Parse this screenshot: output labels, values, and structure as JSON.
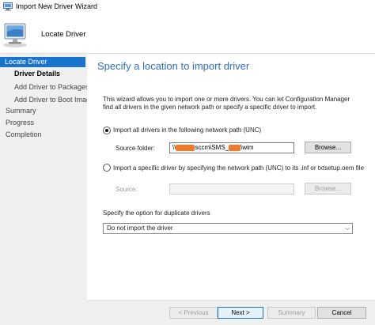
{
  "window": {
    "title": "Import New Driver Wizard"
  },
  "header": {
    "title": "Locate Driver"
  },
  "sidebar": {
    "items": [
      {
        "label": "Locate Driver",
        "state": "active"
      },
      {
        "label": "Driver Details",
        "state": "bold"
      },
      {
        "label": "Add Driver to Packages",
        "state": "sub"
      },
      {
        "label": "Add Driver to Boot Images",
        "state": "sub"
      },
      {
        "label": "Summary",
        "state": "normal"
      },
      {
        "label": "Progress",
        "state": "normal"
      },
      {
        "label": "Completion",
        "state": "normal"
      }
    ]
  },
  "main": {
    "title": "Specify a location to import driver",
    "description": "This wizard allows you to import one or more drivers. You can let Configuration Manager find all drivers in the given network path or specify a specific driver to import.",
    "option_all": {
      "label": "Import all drivers in the following network path (UNC)",
      "selected": true,
      "source_label": "Source folder:",
      "source_value": {
        "prefix": "\\\\",
        "part1": "sccm\\SMS_",
        "part2": "\\wim"
      },
      "browse_label": "Browse..."
    },
    "option_specific": {
      "label": "Import a specific driver by specifying the network path (UNC) to its .inf or txtsetup.oem file",
      "selected": false,
      "source_label": "Source:",
      "source_value": "",
      "browse_label": "Browse..."
    },
    "duplicate": {
      "label": "Specify the option for duplicate drivers",
      "selected": "Do not import the driver"
    }
  },
  "footer": {
    "previous_label": "< Previous",
    "next_label": "Next >",
    "summary_label": "Summary",
    "cancel_label": "Cancel"
  },
  "colors": {
    "accent": "#1874cd",
    "title_blue": "#2f6ec2",
    "sidebar_bg": "#f0f0f0",
    "redaction": "#f07a2a"
  },
  "icons": {
    "app": "computer-wizard-icon",
    "header": "computer-monitor-icon"
  }
}
